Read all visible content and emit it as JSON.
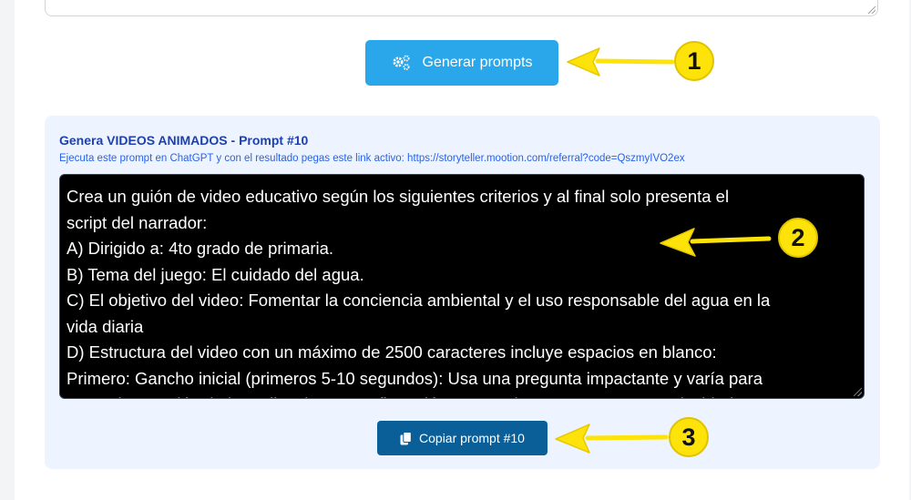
{
  "top_area": {
    "value": ""
  },
  "generate_button": {
    "label": "Generar prompts",
    "icon": "gears-icon"
  },
  "card": {
    "title": "Genera VIDEOS ANIMADOS - Prompt #10",
    "subtitle": "Ejecuta este prompt en ChatGPT y con el resultado pegas este link activo: https://storyteller.mootion.com/referral?code=QszmyIVO2ex",
    "prompt_lines": [
      "Crea un guión de video educativo según los siguientes criterios y al final solo presenta el",
      "script del narrador:",
      "A) Dirigido a: 4to grado de primaria.",
      "B) Tema del juego:  El cuidado del agua.",
      "C) El objetivo del video: Fomentar la conciencia ambiental y el uso responsable del agua en la",
      "vida diaria",
      "D) Estructura del video con un máximo de 2500 caracteres incluye espacios en blanco:",
      "Primero: Gancho inicial (primeros 5-10 segundos): Usa una pregunta impactante y varía para",
      "captar la atención de la audiencia o una afirmación sorprendente para generar curiosidad."
    ],
    "copy_button": {
      "label": "Copiar prompt #10",
      "icon": "copy-icon"
    }
  },
  "annotations": [
    {
      "number": "1",
      "color": "#fde30a"
    },
    {
      "number": "2",
      "color": "#fde30a"
    },
    {
      "number": "3",
      "color": "#fde30a"
    }
  ]
}
